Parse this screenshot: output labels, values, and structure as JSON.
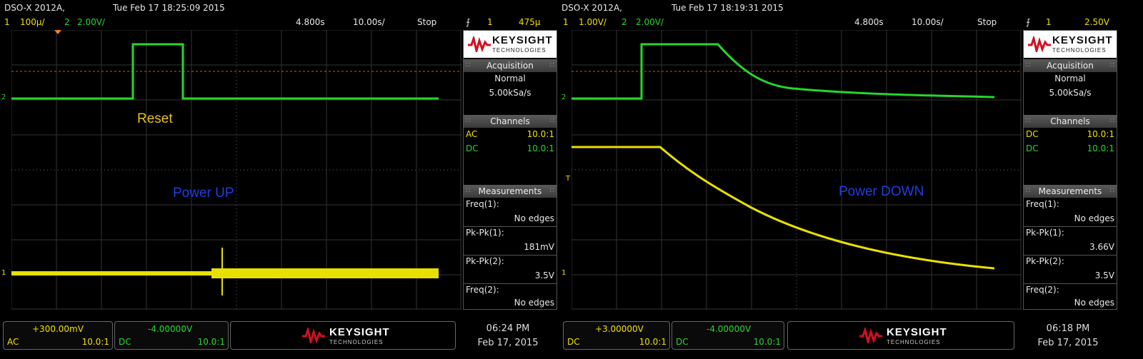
{
  "screens": [
    {
      "model": "DSO-X 2012A,",
      "datetime": "Tue Feb 17 18:25:09 2015",
      "ch1_scale": "100µ/",
      "ch2_num": "2",
      "ch1_num": "1",
      "ch2_scale": "2.00V/",
      "time_pos": "4.800s",
      "time_scale": "10.00s/",
      "run_state": "Stop",
      "trig_ch": "1",
      "trig_level": "475µ",
      "labels": {
        "reset": "Reset",
        "power": "Power UP"
      },
      "panel": {
        "brand": "KEYSIGHT",
        "brand_sub": "TECHNOLOGIES",
        "acq_header": "Acquisition",
        "acq_mode": "Normal",
        "acq_rate": "5.00kSa/s",
        "ch_header": "Channels",
        "ch1_coupling": "AC",
        "ch1_probe": "10.0:1",
        "ch2_coupling": "DC",
        "ch2_probe": "10.0:1",
        "meas_header": "Measurements",
        "m1_label": "Freq(1):",
        "m1_value": "No edges",
        "m2_label": "Pk-Pk(1):",
        "m2_value": "181mV",
        "m3_label": "Pk-Pk(2):",
        "m3_value": "3.5V",
        "m4_label": "Freq(2):",
        "m4_value": "No edges"
      },
      "bottom": {
        "ch1_offset": "+300.00mV",
        "ch1_coupling": "AC",
        "ch1_probe": "10.0:1",
        "ch2_offset": "-4.00000V",
        "ch2_coupling": "DC",
        "ch2_probe": "10.0:1",
        "time": "06:24 PM",
        "date": "Feb 17, 2015"
      }
    },
    {
      "model": "DSO-X 2012A,",
      "datetime": "Tue Feb 17 18:19:31 2015",
      "ch1_scale": "1.00V/",
      "ch2_num": "2",
      "ch1_num": "1",
      "ch2_scale": "2.00V/",
      "time_pos": "4.800s",
      "time_scale": "10.00s/",
      "run_state": "Stop",
      "trig_ch": "1",
      "trig_level": "2.50V",
      "labels": {
        "reset": "",
        "power": "Power DOWN"
      },
      "panel": {
        "brand": "KEYSIGHT",
        "brand_sub": "TECHNOLOGIES",
        "acq_header": "Acquisition",
        "acq_mode": "Normal",
        "acq_rate": "5.00kSa/s",
        "ch_header": "Channels",
        "ch1_coupling": "DC",
        "ch1_probe": "10.0:1",
        "ch2_coupling": "DC",
        "ch2_probe": "10.0:1",
        "meas_header": "Measurements",
        "m1_label": "Freq(1):",
        "m1_value": "No edges",
        "m2_label": "Pk-Pk(1):",
        "m2_value": "3.66V",
        "m3_label": "Pk-Pk(2):",
        "m3_value": "3.5V",
        "m4_label": "Freq(2):",
        "m4_value": "No edges"
      },
      "bottom": {
        "ch1_offset": "+3.00000V",
        "ch1_coupling": "DC",
        "ch1_probe": "10.0:1",
        "ch2_offset": "-4.00000V",
        "ch2_coupling": "DC",
        "ch2_probe": "10.0:1",
        "time": "06:18 PM",
        "date": "Feb 17, 2015"
      }
    }
  ],
  "markers": {
    "ch1": "1",
    "ch2": "2",
    "trig": "T"
  },
  "colors": {
    "ch1": "#f0e000",
    "ch2": "#27d62a",
    "label_yellow": "#e8c020",
    "label_blue": "#1d3fe0"
  }
}
